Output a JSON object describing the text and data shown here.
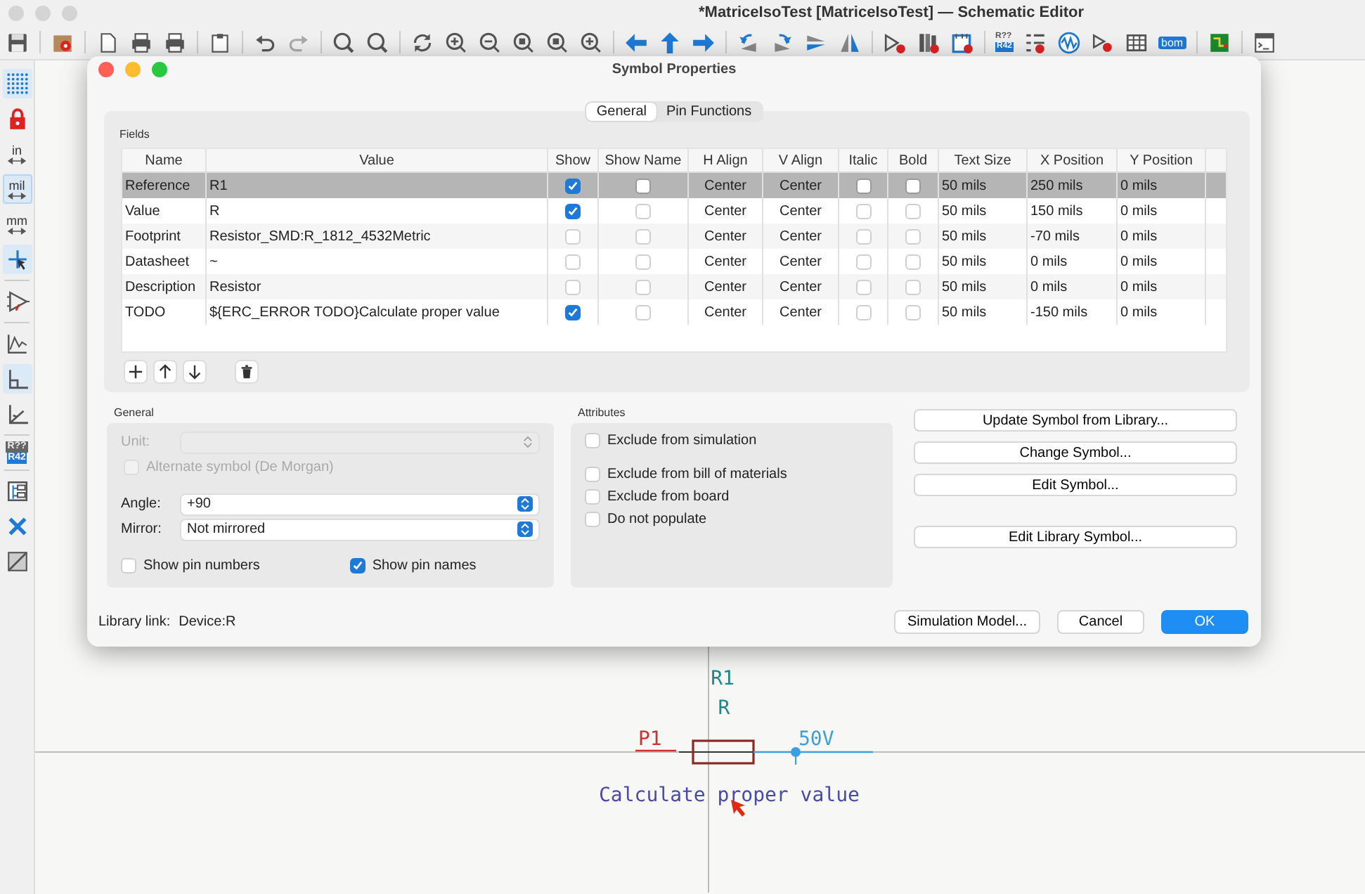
{
  "window": {
    "title": "*MatriceIsoTest [MatriceIsoTest] — Schematic Editor"
  },
  "top_toolbar": {
    "annotate": [
      "R??",
      "R42"
    ],
    "bom": "bom"
  },
  "left_toolbar": {
    "units": [
      {
        "label": "in",
        "selected": false
      },
      {
        "label": "mil",
        "selected": true
      },
      {
        "label": "mm",
        "selected": false
      }
    ],
    "annotate": [
      "R??",
      "R42"
    ]
  },
  "dialog": {
    "title": "Symbol Properties",
    "tabs": [
      {
        "label": "General",
        "selected": true
      },
      {
        "label": "Pin Functions",
        "selected": false
      }
    ],
    "fields": {
      "title": "Fields",
      "columns": [
        "Name",
        "Value",
        "Show",
        "Show Name",
        "H Align",
        "V Align",
        "Italic",
        "Bold",
        "Text Size",
        "X Position",
        "Y Position"
      ],
      "rows": [
        {
          "name": "Reference",
          "value": "R1",
          "show": true,
          "show_name": false,
          "h_align": "Center",
          "v_align": "Center",
          "italic": false,
          "bold": false,
          "text_size": "50 mils",
          "x_position": "250 mils",
          "y_position": "0 mils",
          "selected": true
        },
        {
          "name": "Value",
          "value": "R",
          "show": true,
          "show_name": false,
          "h_align": "Center",
          "v_align": "Center",
          "italic": false,
          "bold": false,
          "text_size": "50 mils",
          "x_position": "150 mils",
          "y_position": "0 mils",
          "selected": false
        },
        {
          "name": "Footprint",
          "value": "Resistor_SMD:R_1812_4532Metric",
          "show": false,
          "show_name": false,
          "h_align": "Center",
          "v_align": "Center",
          "italic": false,
          "bold": false,
          "text_size": "50 mils",
          "x_position": "-70 mils",
          "y_position": "0 mils",
          "selected": false
        },
        {
          "name": "Datasheet",
          "value": "~",
          "show": false,
          "show_name": false,
          "h_align": "Center",
          "v_align": "Center",
          "italic": false,
          "bold": false,
          "text_size": "50 mils",
          "x_position": "0 mils",
          "y_position": "0 mils",
          "selected": false
        },
        {
          "name": "Description",
          "value": "Resistor",
          "show": false,
          "show_name": false,
          "h_align": "Center",
          "v_align": "Center",
          "italic": false,
          "bold": false,
          "text_size": "50 mils",
          "x_position": "0 mils",
          "y_position": "0 mils",
          "selected": false
        },
        {
          "name": "TODO",
          "value": "${ERC_ERROR TODO}Calculate proper value",
          "show": true,
          "show_name": false,
          "h_align": "Center",
          "v_align": "Center",
          "italic": false,
          "bold": false,
          "text_size": "50 mils",
          "x_position": "-150 mils",
          "y_position": "0 mils",
          "selected": false
        }
      ]
    },
    "general": {
      "title": "General",
      "unit": {
        "label": "Unit:",
        "disabled": true
      },
      "alternate": {
        "label": "Alternate symbol (De Morgan)",
        "checked": false,
        "disabled": true
      },
      "angle": {
        "label": "Angle:",
        "value": "+90"
      },
      "mirror": {
        "label": "Mirror:",
        "value": "Not mirrored"
      },
      "show_pin_numbers": {
        "label": "Show pin numbers",
        "checked": false
      },
      "show_pin_names": {
        "label": "Show pin names",
        "checked": true
      }
    },
    "attributes": {
      "title": "Attributes",
      "items": [
        {
          "label": "Exclude from simulation",
          "checked": false
        },
        {
          "label": "Exclude from bill of materials",
          "checked": false
        },
        {
          "label": "Exclude from board",
          "checked": false
        },
        {
          "label": "Do not populate",
          "checked": false
        }
      ]
    },
    "actions": [
      "Update Symbol from Library...",
      "Change Symbol...",
      "Edit Symbol...",
      "Edit Library Symbol..."
    ],
    "library_link": {
      "label": "Library link:",
      "value": "Device:R"
    },
    "footer_buttons": [
      {
        "label": "Simulation Model...",
        "kind": "normal"
      },
      {
        "label": "Cancel",
        "kind": "normal"
      },
      {
        "label": "OK",
        "kind": "default"
      }
    ]
  },
  "schematic": {
    "reference": "R1",
    "value": "R",
    "net_label": "P1",
    "power_label": "50V",
    "todo_text": "Calculate proper value"
  }
}
